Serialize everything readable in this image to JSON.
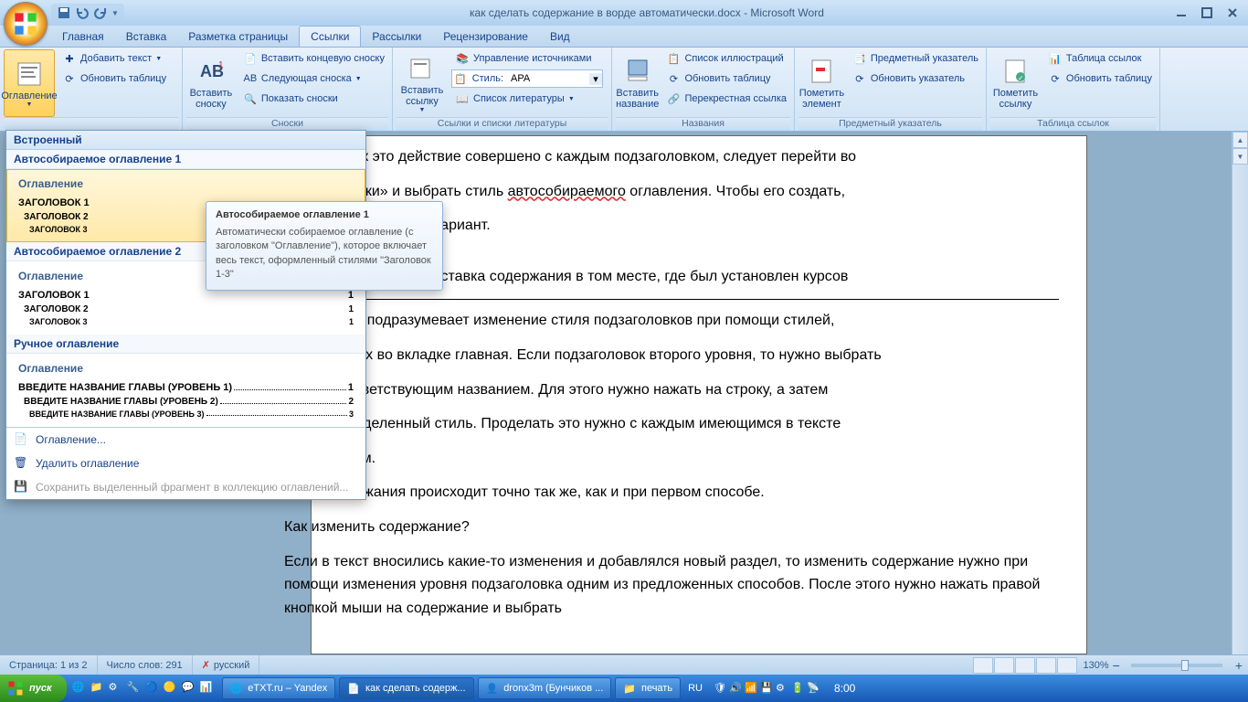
{
  "title": "как сделать содержание в ворде автоматически.docx - Microsoft Word",
  "tabs": [
    "Главная",
    "Вставка",
    "Разметка страницы",
    "Ссылки",
    "Рассылки",
    "Рецензирование",
    "Вид"
  ],
  "ribbon": {
    "toc": {
      "big": "Оглавление",
      "add_text": "Добавить текст",
      "update": "Обновить таблицу",
      "group": ""
    },
    "footnotes": {
      "big": "Вставить сноску",
      "insert_end": "Вставить концевую сноску",
      "next": "Следующая сноска",
      "show": "Показать сноски",
      "group": "Сноски"
    },
    "citations": {
      "big": "Вставить ссылку",
      "manage": "Управление источниками",
      "style_label": "Стиль:",
      "style_value": "APA",
      "biblio": "Список литературы",
      "group": "Ссылки и списки литературы"
    },
    "captions": {
      "big": "Вставить название",
      "list": "Список иллюстраций",
      "update": "Обновить таблицу",
      "cross": "Перекрестная ссылка",
      "group": "Названия"
    },
    "index": {
      "big": "Пометить элемент",
      "insert": "Предметный указатель",
      "update": "Обновить указатель",
      "group": "Предметный указатель"
    },
    "toa": {
      "big": "Пометить ссылку",
      "insert": "Таблица ссылок",
      "update": "Обновить таблицу",
      "group": "Таблица ссылок"
    }
  },
  "toc_dropdown": {
    "builtin": "Встроенный",
    "auto1_label": "Автособираемое оглавление 1",
    "auto2_label": "Автособираемое оглавление 2",
    "manual_label": "Ручное оглавление",
    "preview_title": "Оглавление",
    "h1": "ЗАГОЛОВОК 1",
    "h2": "Заголовок 2",
    "h3": "Заголовок 3",
    "manual_h1": "ВВЕДИТЕ НАЗВАНИЕ ГЛАВЫ (УРОВЕНЬ 1)",
    "manual_h2": "Введите название главы (уровень 2)",
    "manual_h3": "Введите название главы (уровень 3)",
    "page1": "1",
    "page2": "2",
    "page3": "3",
    "insert_toc": "Оглавление...",
    "remove_toc": "Удалить оглавление",
    "save_selection": "Сохранить выделенный фрагмент в коллекцию оглавлений..."
  },
  "tooltip": {
    "title": "Автособираемое оглавление 1",
    "body": "Автоматически собираемое оглавление (с заголовком \"Оглавление\"), которое включает весь текст, оформленный стилями \"Заголовок 1-3\""
  },
  "document": {
    "p1a": ", как это действие совершено с каждым подзаголовком, следует перейти во",
    "p1b": "сылки» и выбрать стиль ",
    "p1c": "автособираемого",
    "p1d": " оглавления. Чтобы его создать,",
    "p1e": "а выбранный вариант.",
    "p2": "о произойдет вставка содержания в том месте, где был установлен курсов",
    "p3a": "соб подразумевает изменение стиля подзаголовков при помощи стилей,",
    "p3b": "нных во вкладке главная. Если подзаголовок второго уровня, то нужно выбрать",
    "p3c": "оответствующим названием. Для этого нужно нажать на строку, а затем",
    "p3d": "пределенный стиль. Проделать это нужно с каждым имеющимся в тексте",
    "p3e": "вком.",
    "p4": "держания происходит точно так же, как и при первом способе.",
    "p5": "Как изменить содержание?",
    "p6": "Если в текст вносились какие-то изменения и добавлялся новый раздел, то изменить содержание нужно при помощи изменения уровня подзаголовка одним из предложенных способов. После этого нужно нажать правой кнопкой мыши на содержание и выбрать"
  },
  "statusbar": {
    "page": "Страница: 1 из 2",
    "words": "Число слов: 291",
    "lang": "русский",
    "zoom": "130%"
  },
  "taskbar": {
    "start": "пуск",
    "items": [
      "eTXT.ru – Yandex",
      "как сделать содерж...",
      "dronx3m (Бунчиков ...",
      "печать"
    ],
    "lang": "RU",
    "time": "8:00"
  }
}
